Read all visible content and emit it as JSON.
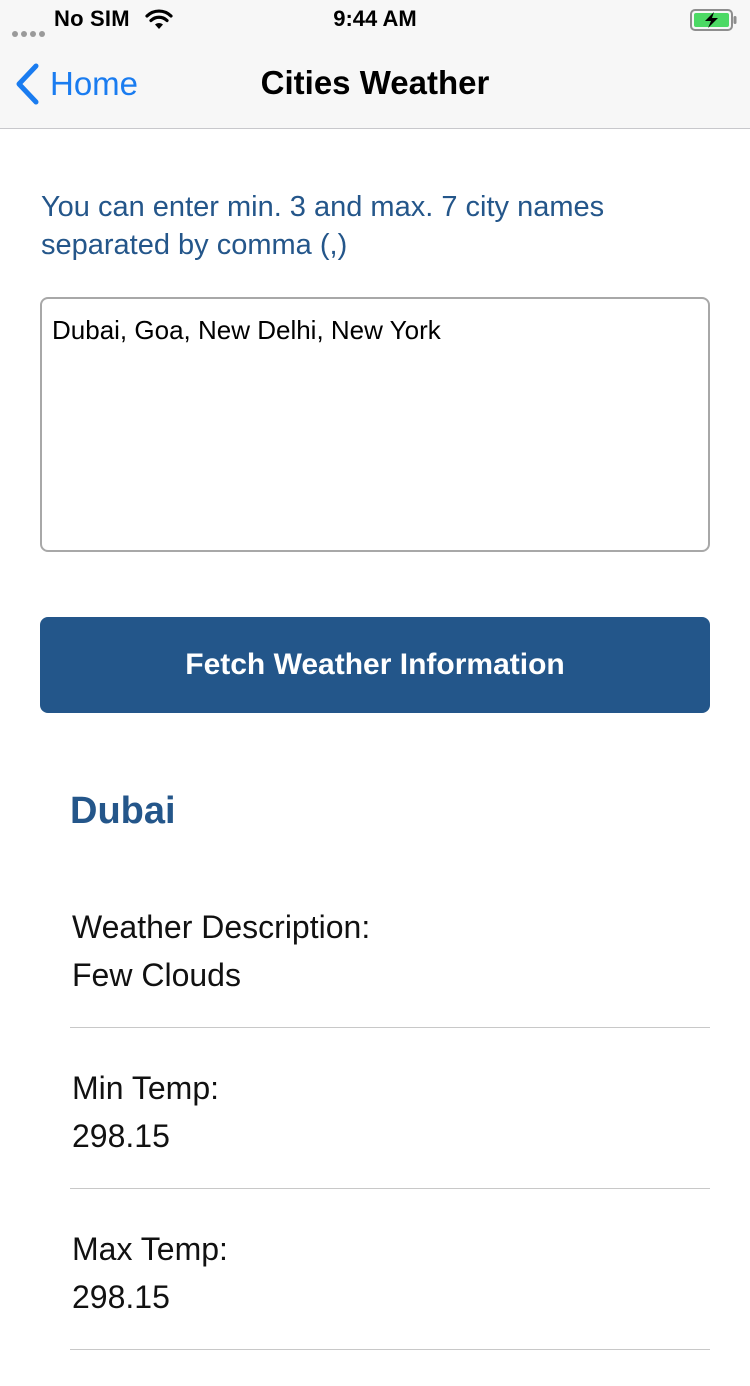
{
  "status_bar": {
    "carrier": "No SIM",
    "time": "9:44 AM",
    "battery_color": "#4cd964"
  },
  "nav": {
    "back_label": "Home",
    "title": "Cities Weather",
    "accent_color": "#1a7cf0"
  },
  "form": {
    "hint": "You can enter min. 3 and max. 7 city names separated by comma (,)",
    "cities_value": "Dubai, Goa, New Delhi, New York",
    "button_label": "Fetch Weather Information",
    "brand_color": "#23568a"
  },
  "results": {
    "city": "Dubai",
    "rows": [
      {
        "label": "Weather Description:",
        "value": "Few Clouds"
      },
      {
        "label": "Min Temp:",
        "value": "298.15"
      },
      {
        "label": "Max Temp:",
        "value": "298.15"
      }
    ]
  }
}
